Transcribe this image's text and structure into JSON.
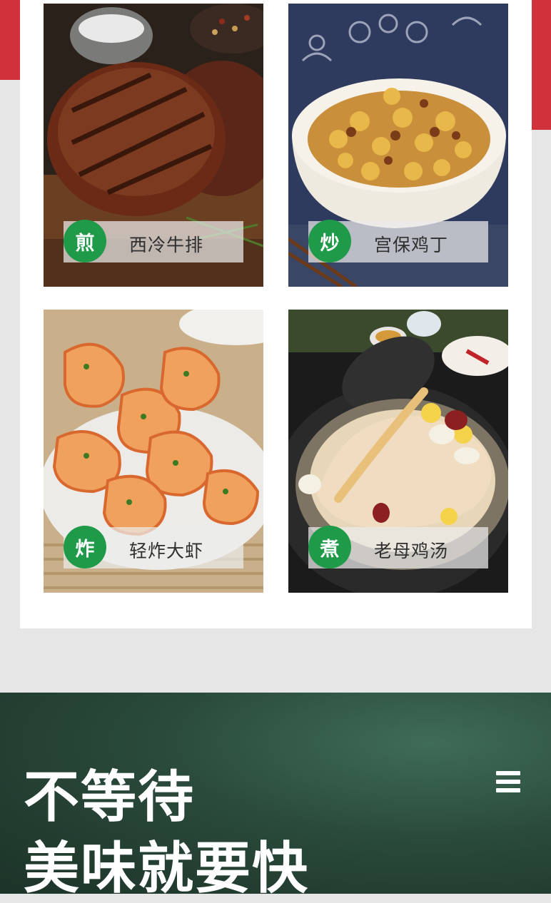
{
  "dishes": [
    {
      "method": "煎",
      "name": "西冷牛排"
    },
    {
      "method": "炒",
      "name": "宫保鸡丁"
    },
    {
      "method": "炸",
      "name": "轻炸大虾"
    },
    {
      "method": "煮",
      "name": "老母鸡汤"
    }
  ],
  "slogan": {
    "line1": "不等待",
    "line2": "美味就要快"
  },
  "colors": {
    "accent_green": "#1f9a48",
    "brand_red": "#d1313a",
    "dark_green": "#2a4a3b"
  },
  "icons": {
    "menu": "menu-icon"
  }
}
